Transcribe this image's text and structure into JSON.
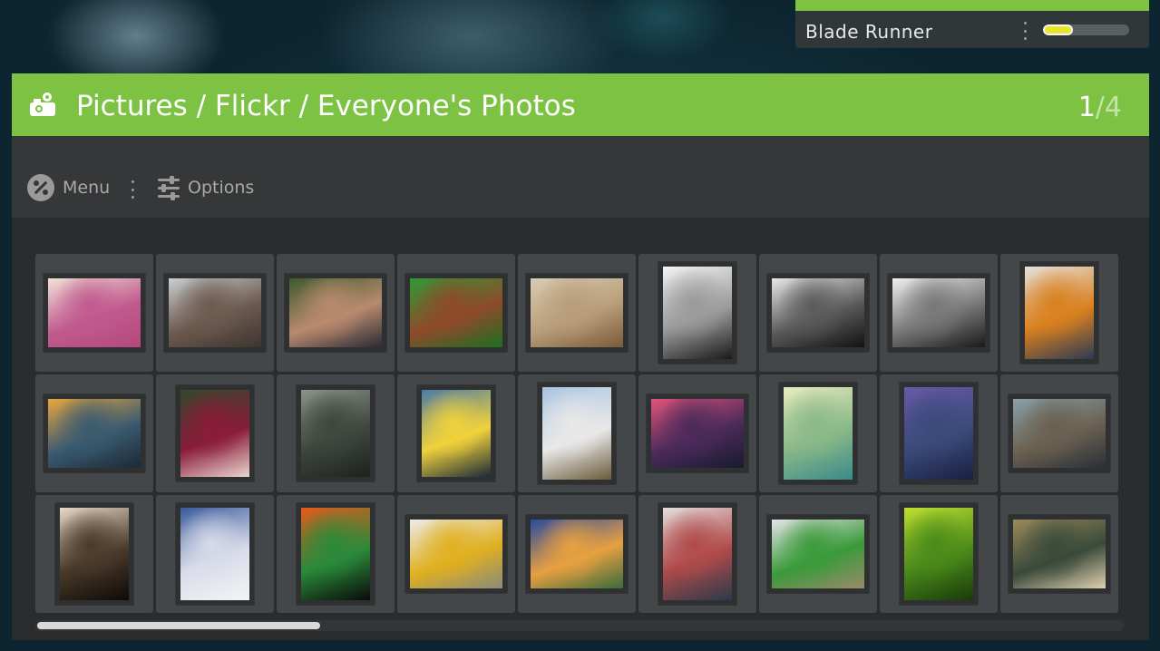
{
  "now_playing": {
    "title": "Blade Runner",
    "progress": 0.35,
    "accent_color": "#7dc243",
    "progress_color": "#e8e52a"
  },
  "header": {
    "icon": "pictures-icon",
    "breadcrumb": "Pictures / Flickr / Everyone's Photos",
    "page_current": "1",
    "page_separator": "/",
    "page_total": "4",
    "color": "#7dc243"
  },
  "toolbar": {
    "menu_label": "Menu",
    "menu_icon": "menu-badge-icon",
    "options_label": "Options",
    "options_icon": "sliders-icon"
  },
  "photos": [
    {
      "name": "photo-baby-pink-hat",
      "shape": "land",
      "colors": [
        "#f1e1d6",
        "#c05a8e",
        "#b4487d"
      ]
    },
    {
      "name": "photo-crowd-street",
      "shape": "land",
      "colors": [
        "#c9cdd2",
        "#6d5a4f",
        "#3d3530"
      ]
    },
    {
      "name": "photo-kids-water-guns",
      "shape": "land",
      "colors": [
        "#3d5a2e",
        "#b98a6e",
        "#2a2a33"
      ]
    },
    {
      "name": "photo-hair-grass",
      "shape": "land",
      "colors": [
        "#2f9a36",
        "#8e4a2a",
        "#1e6e22"
      ]
    },
    {
      "name": "photo-jumping-dancers",
      "shape": "land",
      "colors": [
        "#d8ccb4",
        "#b89d7a",
        "#7a5a3a"
      ]
    },
    {
      "name": "photo-boy-sunglasses",
      "shape": "port",
      "colors": [
        "#f4f4f4",
        "#9a9a9a",
        "#1a1a1a"
      ]
    },
    {
      "name": "photo-kitchen-sink",
      "shape": "land",
      "colors": [
        "#e8e8e8",
        "#5a5a5a",
        "#121212"
      ]
    },
    {
      "name": "photo-open-book",
      "shape": "land",
      "colors": [
        "#efefef",
        "#777777",
        "#1a1a1a"
      ]
    },
    {
      "name": "photo-orange-top",
      "shape": "port",
      "colors": [
        "#e5e1dc",
        "#d9801e",
        "#2b3a55"
      ]
    },
    {
      "name": "photo-sunset-pier",
      "shape": "land",
      "colors": [
        "#e8a740",
        "#3a5a70",
        "#1c2a35"
      ]
    },
    {
      "name": "photo-red-hair-girl",
      "shape": "sq",
      "colors": [
        "#2e4a2a",
        "#8a1c3a",
        "#e9d6d0"
      ]
    },
    {
      "name": "photo-misty-cliff",
      "shape": "sq",
      "colors": [
        "#8a948a",
        "#3e463e",
        "#1e221e"
      ]
    },
    {
      "name": "photo-city-bicycle",
      "shape": "sq",
      "colors": [
        "#4a7aa8",
        "#f1d23a",
        "#1a2a3a"
      ]
    },
    {
      "name": "photo-wedding-road",
      "shape": "port",
      "colors": [
        "#a8c4e0",
        "#e8e8e8",
        "#6a5a3a"
      ]
    },
    {
      "name": "photo-purple-sea",
      "shape": "land",
      "colors": [
        "#e0547a",
        "#4a2a5a",
        "#1a1a2e"
      ]
    },
    {
      "name": "photo-dandelion",
      "shape": "port",
      "colors": [
        "#e8ecc0",
        "#8ab888",
        "#3a8a8a"
      ]
    },
    {
      "name": "photo-rocky-shore",
      "shape": "port",
      "colors": [
        "#6a5aa8",
        "#3a4a7a",
        "#1a2040"
      ]
    },
    {
      "name": "photo-sparrow-bread",
      "shape": "land",
      "colors": [
        "#8aa0a8",
        "#6a6050",
        "#2a3038"
      ]
    },
    {
      "name": "photo-legs-tree",
      "shape": "port",
      "colors": [
        "#e8d8c8",
        "#4a3a2a",
        "#0e0a08"
      ]
    },
    {
      "name": "photo-bare-tree-snow",
      "shape": "port",
      "colors": [
        "#3a5a9a",
        "#d8dcea",
        "#f4f4f4"
      ]
    },
    {
      "name": "photo-green-figure",
      "shape": "port",
      "colors": [
        "#e85a1a",
        "#2a8a3a",
        "#0a0a0a"
      ]
    },
    {
      "name": "photo-eagle",
      "shape": "land",
      "colors": [
        "#ececec",
        "#e0b020",
        "#8a8a7a"
      ]
    },
    {
      "name": "photo-cloud-mountains",
      "shape": "land",
      "colors": [
        "#2a4aa0",
        "#e8a040",
        "#3a6a3a"
      ]
    },
    {
      "name": "photo-craft-room",
      "shape": "port",
      "colors": [
        "#e4dede",
        "#b04a4a",
        "#2a3a4a"
      ]
    },
    {
      "name": "photo-seeds-leaves",
      "shape": "land",
      "colors": [
        "#e4e4e8",
        "#3a9a3a",
        "#9a8a6a"
      ]
    },
    {
      "name": "photo-curly-tendril",
      "shape": "port",
      "colors": [
        "#c0e030",
        "#4a8a1a",
        "#1a3a0a"
      ]
    },
    {
      "name": "photo-alley-girl",
      "shape": "land",
      "colors": [
        "#9a8a5a",
        "#3a4a3a",
        "#e0d0b0"
      ]
    }
  ],
  "scroll_position": 0.26
}
